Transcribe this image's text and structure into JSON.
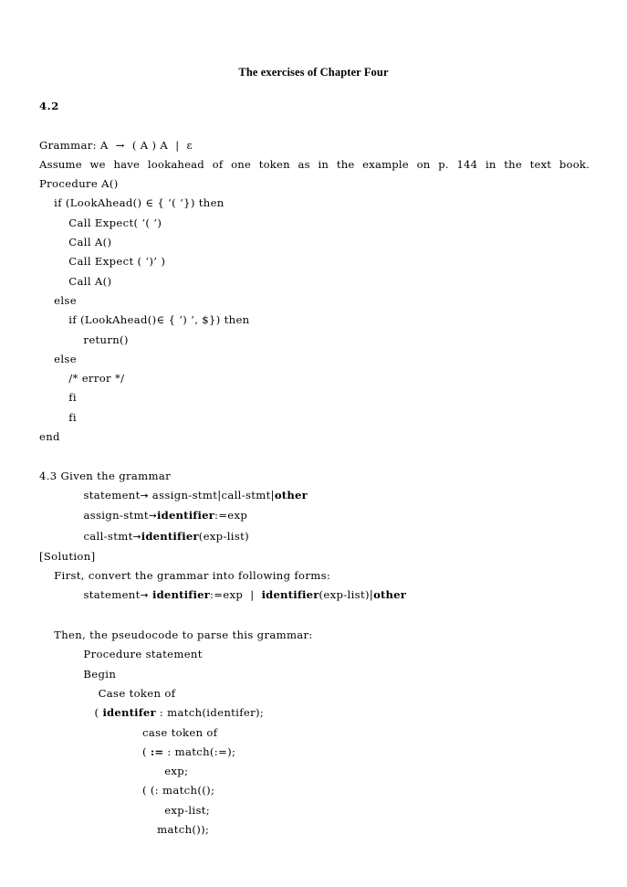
{
  "document": {
    "title": "The exercises of Chapter Four"
  },
  "sections": [
    {
      "number": "4.2",
      "lines": [
        {
          "id": "l1",
          "text": "Grammar: A  →  ( A ) A  |  ε"
        },
        {
          "id": "l2",
          "text": "Assume we have lookahead of one token as in the example on p. 144 in the text book."
        },
        {
          "id": "l3",
          "text": "Procedure A()"
        },
        {
          "id": "l4",
          "text": "    if (LookAhead() ∈ { ‘( ‘}) then"
        },
        {
          "id": "l5",
          "text": "        Call Expect( ‘( ‘)"
        },
        {
          "id": "l6",
          "text": "        Call A()"
        },
        {
          "id": "l7",
          "text": "        Call Expect ( ‘)’ )"
        },
        {
          "id": "l8",
          "text": "        Call A()"
        },
        {
          "id": "l9",
          "text": "    else"
        },
        {
          "id": "l10",
          "text": "        if (LookAhead()∈ { ‘) ‘, $}) then"
        },
        {
          "id": "l11",
          "text": "            return()"
        },
        {
          "id": "l12",
          "text": "    else"
        },
        {
          "id": "l13",
          "text": "        /* error */"
        },
        {
          "id": "l14",
          "text": "        fi"
        },
        {
          "id": "l15",
          "text": "        fi"
        },
        {
          "id": "l16",
          "text": "end"
        }
      ]
    },
    {
      "number": "4.3",
      "heading": "4.3 Given the grammar",
      "grammar": [
        {
          "id": "g1",
          "indent": "            ",
          "lhs": "statement",
          "arrow": "→",
          "parts": [
            {
              "text": " assign-stmt",
              "bold": false
            },
            {
              "text": "|",
              "bold": false
            },
            {
              "text": "call-stmt",
              "bold": false
            },
            {
              "text": "|",
              "bold": false
            },
            {
              "text": "other",
              "bold": true
            }
          ]
        },
        {
          "id": "g2",
          "indent": "            ",
          "lhs": "assign-stmt",
          "arrow": "→",
          "parts": [
            {
              "text": "identifier",
              "bold": true
            },
            {
              "text": ":=exp",
              "bold": false
            }
          ]
        },
        {
          "id": "g3",
          "indent": "            ",
          "lhs": "call-stmt",
          "arrow": "→",
          "parts": [
            {
              "text": "identifier",
              "bold": true
            },
            {
              "text": "(exp-list)",
              "bold": false
            }
          ]
        }
      ],
      "solution_label": "[Solution]",
      "solution_intro": "    First, convert the grammar into following forms:",
      "converted": {
        "id": "c1",
        "indent": "            ",
        "lhs": "statement",
        "arrow": "→",
        "parts": [
          {
            "text": " identifier",
            "bold": true
          },
          {
            "text": ":=exp  |  ",
            "bold": false
          },
          {
            "text": "identifier",
            "bold": true
          },
          {
            "text": "(exp-list)",
            "bold": false
          },
          {
            "text": "|",
            "bold": false
          },
          {
            "text": "other",
            "bold": true
          }
        ]
      },
      "pseudocode_intro": "    Then, the pseudocode to parse this grammar:",
      "pseudocode": [
        {
          "id": "p1",
          "text": "            Procedure statement"
        },
        {
          "id": "p2",
          "text": "            Begin"
        },
        {
          "id": "p3",
          "text": "                Case token of"
        },
        {
          "id": "p4",
          "pre": "               ( ",
          "bold": "identifer",
          "post": " : match(identifer);"
        },
        {
          "id": "p5",
          "text": "                            case token of"
        },
        {
          "id": "p6",
          "pre": "                            ( ",
          "bold": ":=",
          "post": " : match(:=);"
        },
        {
          "id": "p7",
          "text": "                                  exp;"
        },
        {
          "id": "p8",
          "text": "                            ( (: match(();"
        },
        {
          "id": "p9",
          "text": "                                  exp-list;"
        },
        {
          "id": "p10",
          "text": "                                match());"
        }
      ]
    }
  ]
}
